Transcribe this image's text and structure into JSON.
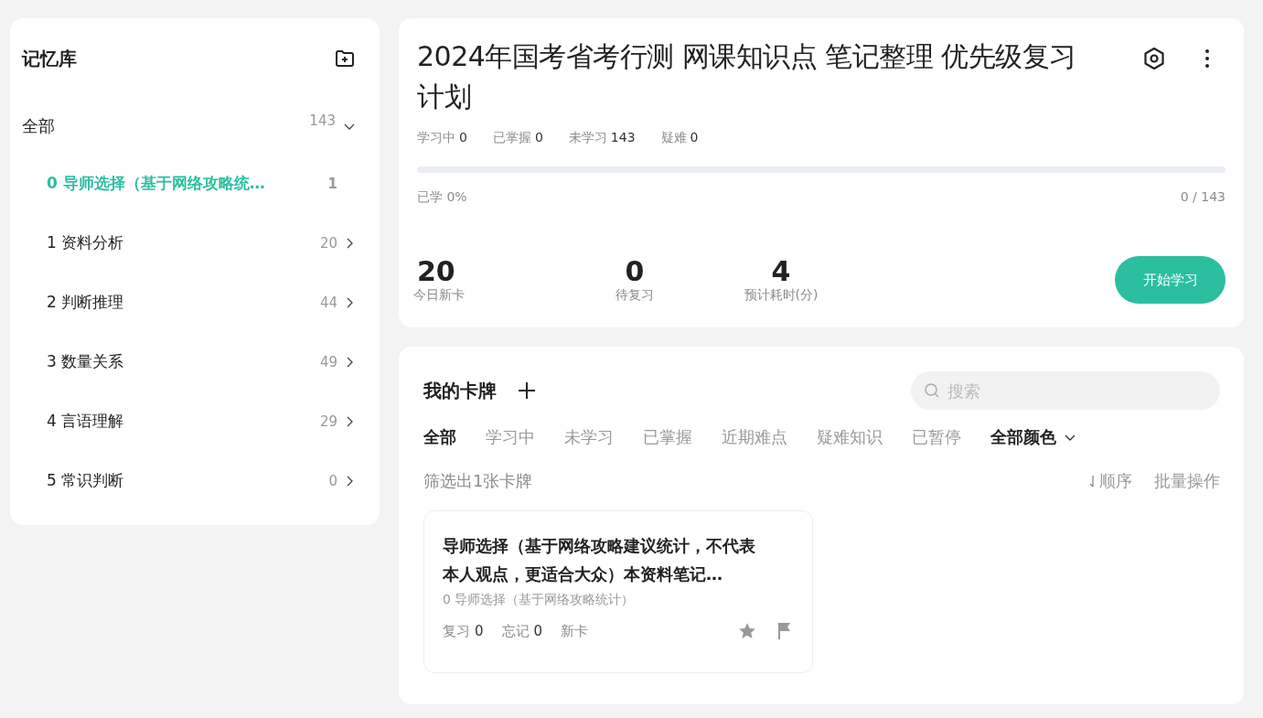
{
  "sidebar": {
    "title": "记忆库",
    "root": {
      "label": "全部",
      "count": "143",
      "expanded": true,
      "children": [
        {
          "label": "0 导师选择（基于网络攻略统…",
          "count": "1",
          "selected": true
        },
        {
          "label": "1 资料分析",
          "count": "20",
          "selected": false
        },
        {
          "label": "2 判断推理",
          "count": "44",
          "selected": false
        },
        {
          "label": "3 数量关系",
          "count": "49",
          "selected": false
        },
        {
          "label": "4 言语理解",
          "count": "29",
          "selected": false
        },
        {
          "label": "5 常识判断",
          "count": "0",
          "selected": false
        }
      ]
    }
  },
  "deck": {
    "title": "2024年国考省考行测 网课知识点 笔记整理 优先级复习计划",
    "stats": [
      {
        "label": "学习中",
        "value": "0"
      },
      {
        "label": "已掌握",
        "value": "0"
      },
      {
        "label": "未学习",
        "value": "143"
      },
      {
        "label": "疑难",
        "value": "0"
      }
    ],
    "progress": {
      "level": 0,
      "label": "已学 0%",
      "reading": "0 / 143"
    },
    "summary": [
      {
        "value": "20",
        "label": "今日新卡"
      },
      {
        "value": "0",
        "label": "待复习"
      },
      {
        "value": "4",
        "label": "预计耗时(分)"
      }
    ],
    "start_button": "开始学习"
  },
  "cards": {
    "title": "我的卡牌",
    "search": {
      "placeholder": "搜索"
    },
    "filters": [
      {
        "label": "全部",
        "selected": true
      },
      {
        "label": "学习中",
        "selected": false
      },
      {
        "label": "未学习",
        "selected": false
      },
      {
        "label": "已掌握",
        "selected": false
      },
      {
        "label": "近期难点",
        "selected": false
      },
      {
        "label": "疑难知识",
        "selected": false
      },
      {
        "label": "已暂停",
        "selected": false
      }
    ],
    "color_filter": "全部颜色",
    "result": "筛选出1张卡牌",
    "sort": "顺序",
    "batch": "批量操作",
    "items": [
      {
        "title": "导师选择（基于网络攻略建议统计，不代表本人观点，更适合大众）本资料笔记…",
        "path": "0 导师选择（基于网络攻略统计）",
        "stats": [
          {
            "label": "复习",
            "value": "0"
          },
          {
            "label": "忘记",
            "value": "0"
          }
        ],
        "status": "新卡"
      }
    ]
  }
}
